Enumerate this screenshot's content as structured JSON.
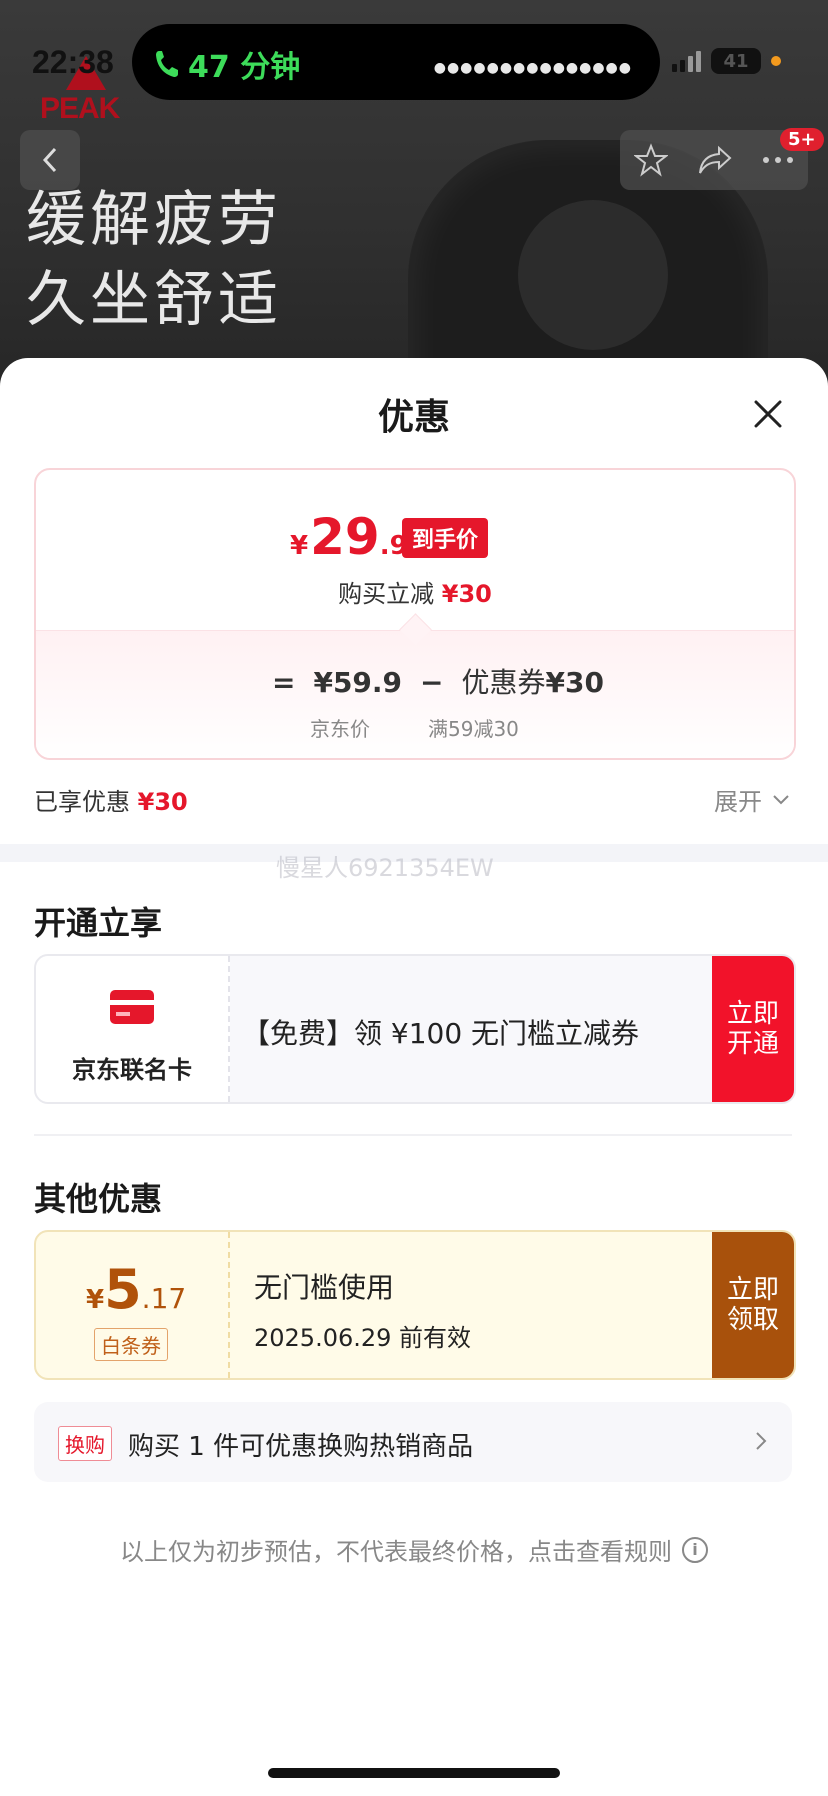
{
  "status_bar": {
    "time": "22:38",
    "call_duration": "47 分钟",
    "battery": "41"
  },
  "background": {
    "brand_logo": "PEAK",
    "headline_line1": "缓解疲劳",
    "headline_line2": "久坐舒适",
    "cart_badge": "5+"
  },
  "sheet": {
    "title": "优惠",
    "price_card": {
      "currency": "¥",
      "final_int": "29",
      "final_dec": ".9",
      "final_tag": "到手价",
      "reduce_prefix": "购买立减 ",
      "reduce_amount": "¥30",
      "equals": "=",
      "jd_price": "¥59.9",
      "minus": "−",
      "coupon_label": "优惠券",
      "coupon_amount": "¥30",
      "jd_price_caption": "京东价",
      "coupon_caption": "满59减30"
    },
    "enjoyed_label": "已享优惠 ",
    "enjoyed_amount": "¥30",
    "expand_label": "展开",
    "watermark": "慢星人6921354EW",
    "section_open": {
      "title": "开通立享",
      "card_name": "京东联名卡",
      "desc": "【免费】领 ¥100 无门槛立减券",
      "cta_line1": "立即",
      "cta_line2": "开通"
    },
    "section_other": {
      "title": "其他优惠",
      "coupon_currency": "¥",
      "coupon_int": "5",
      "coupon_dec": ".17",
      "coupon_type": "白条券",
      "coupon_title": "无门槛使用",
      "coupon_validity": "2025.06.29 前有效",
      "cta_line1": "立即",
      "cta_line2": "领取"
    },
    "exchange": {
      "tag": "换购",
      "text": "购买 1 件可优惠换购热销商品"
    },
    "footnote": "以上仅为初步预估，不代表最终价格，点击查看规则"
  },
  "colors": {
    "accent_red": "#e5172b",
    "coupon_brown": "#a8510c",
    "call_green": "#3ddc5a"
  },
  "icons": [
    "back-arrow-icon",
    "star-icon",
    "share-icon",
    "more-icon",
    "close-icon",
    "phone-icon",
    "credit-card-icon",
    "chevron-down-icon",
    "chevron-right-icon",
    "info-icon"
  ]
}
